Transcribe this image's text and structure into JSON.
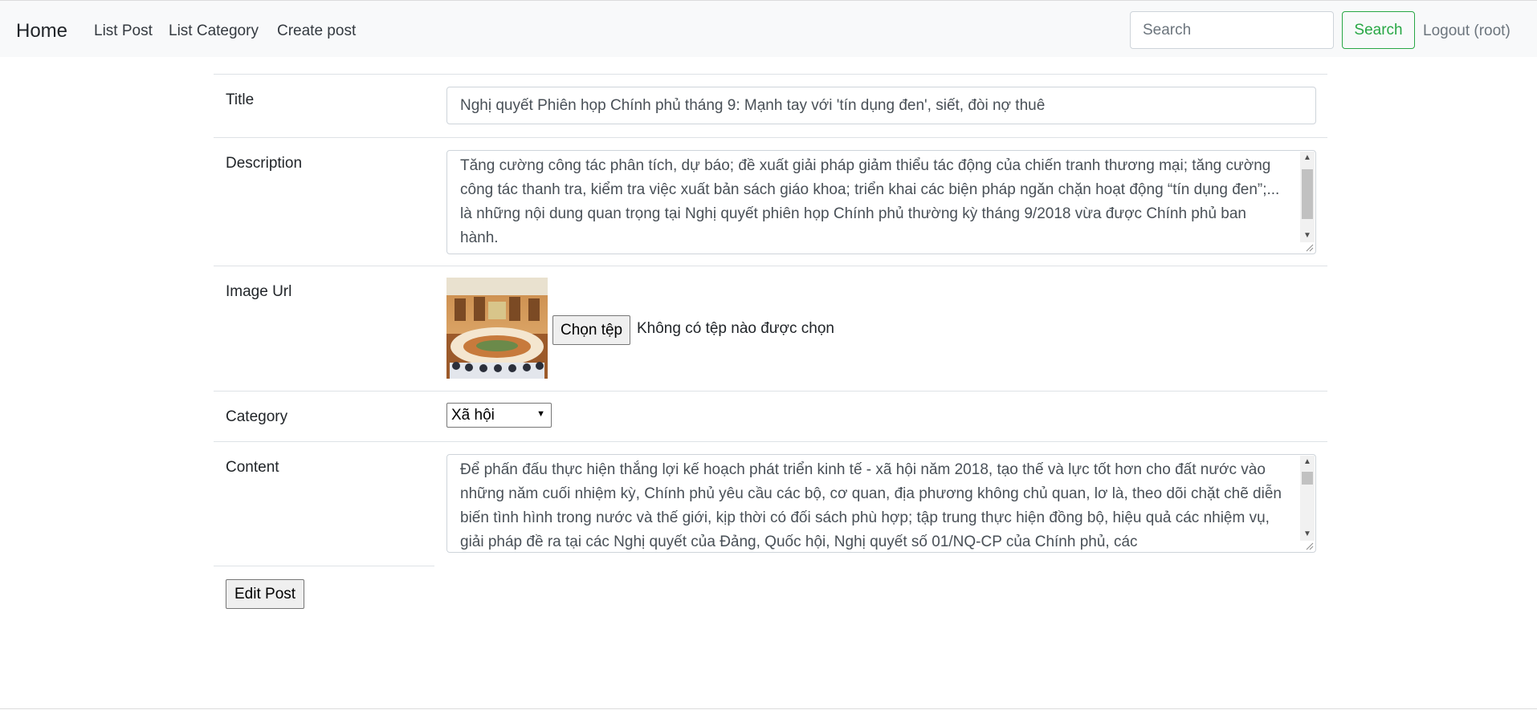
{
  "navbar": {
    "brand": "Home",
    "links": [
      "List Post",
      "List Category",
      "Create post"
    ],
    "search_placeholder": "Search",
    "search_button": "Search",
    "logout": "Logout (root)"
  },
  "form": {
    "title": {
      "label": "Title",
      "value": "Nghị quyết Phiên họp Chính phủ tháng 9: Mạnh tay với 'tín dụng đen', siết, đòi nợ thuê"
    },
    "description": {
      "label": "Description",
      "value": "Tăng cường công tác phân tích, dự báo; đề xuất giải pháp giảm thiểu tác động của chiến tranh thương mại; tăng cường công tác thanh tra, kiểm tra việc xuất bản sách giáo khoa; triển khai các biện pháp ngăn chặn hoạt động “tín dụng đen”;... là những nội dung quan trọng tại Nghị quyết phiên họp Chính phủ thường kỳ tháng 9/2018 vừa được Chính phủ ban hành."
    },
    "image": {
      "label": "Image Url",
      "choose_button": "Chọn tệp",
      "no_file_text": "Không có tệp nào được chọn"
    },
    "category": {
      "label": "Category",
      "selected": "Xã hội"
    },
    "content": {
      "label": "Content",
      "value": "Để phấn đấu thực hiện thắng lợi kế hoạch phát triển kinh tế - xã hội năm 2018, tạo thế và lực tốt hơn cho đất nước vào những năm cuối nhiệm kỳ, Chính phủ yêu cầu các bộ, cơ quan, địa phương không chủ quan, lơ là, theo dõi chặt chẽ diễn biến tình hình trong nước và thế giới, kịp thời có đối sách phù hợp; tập trung thực hiện đồng bộ, hiệu quả các nhiệm vụ, giải pháp đề ra tại các Nghị quyết của Đảng, Quốc hội, Nghị quyết số 01/NQ-CP của Chính phủ, các"
    },
    "submit": "Edit Post"
  }
}
